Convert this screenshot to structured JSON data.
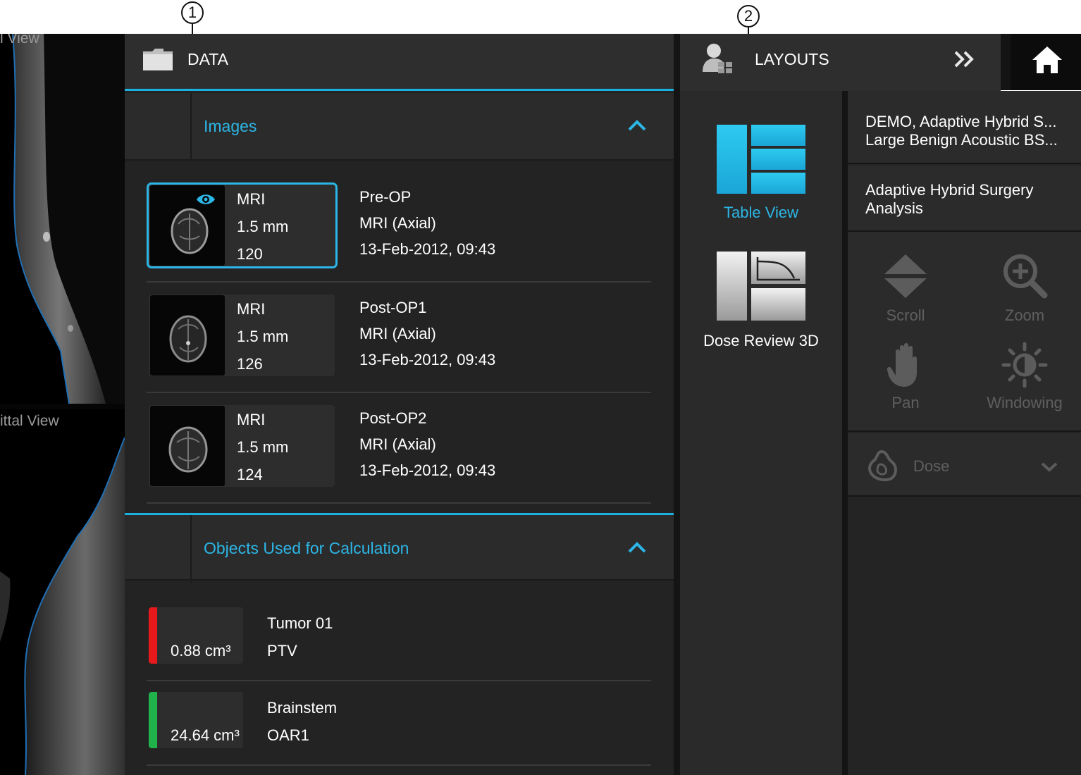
{
  "callouts": {
    "one": "1",
    "two": "2"
  },
  "viewer": {
    "top_pane_label": "l View",
    "bottom_pane_label": "ittal View"
  },
  "data_panel": {
    "title": "DATA",
    "images_section": {
      "title": "Images",
      "items": [
        {
          "modality": "MRI",
          "slice": "1.5 mm",
          "count": "120",
          "name": "Pre-OP",
          "series": "MRI (Axial)",
          "datetime": "13-Feb-2012, 09:43",
          "selected": true
        },
        {
          "modality": "MRI",
          "slice": "1.5 mm",
          "count": "126",
          "name": "Post-OP1",
          "series": "MRI (Axial)",
          "datetime": "13-Feb-2012, 09:43",
          "selected": false
        },
        {
          "modality": "MRI",
          "slice": "1.5 mm",
          "count": "124",
          "name": "Post-OP2",
          "series": "MRI (Axial)",
          "datetime": "13-Feb-2012, 09:43",
          "selected": false
        }
      ]
    },
    "objects_section": {
      "title": "Objects Used for Calculation",
      "items": [
        {
          "volume": "0.88 cm³",
          "name": "Tumor 01",
          "type": "PTV",
          "color": "#e8191b"
        },
        {
          "volume": "24.64 cm³",
          "name": "Brainstem",
          "type": "OAR1",
          "color": "#22b24c"
        }
      ]
    }
  },
  "layouts_panel": {
    "title": "LAYOUTS",
    "items": [
      {
        "label": "Table View",
        "active": true
      },
      {
        "label": "Dose Review 3D",
        "active": false
      }
    ]
  },
  "right_panel": {
    "patient_line1": "DEMO, Adaptive Hybrid S...",
    "patient_line2": "Large Benign Acoustic BS...",
    "analysis_line1": "Adaptive Hybrid Surgery",
    "analysis_line2": "Analysis",
    "tools": {
      "scroll": "Scroll",
      "zoom": "Zoom",
      "pan": "Pan",
      "windowing": "Windowing"
    },
    "dose_label": "Dose"
  },
  "colors": {
    "accent": "#2cb6e6",
    "panel_bg": "#232323",
    "header_bg": "#2e2e2e",
    "disabled_text": "#5f5f5f"
  }
}
